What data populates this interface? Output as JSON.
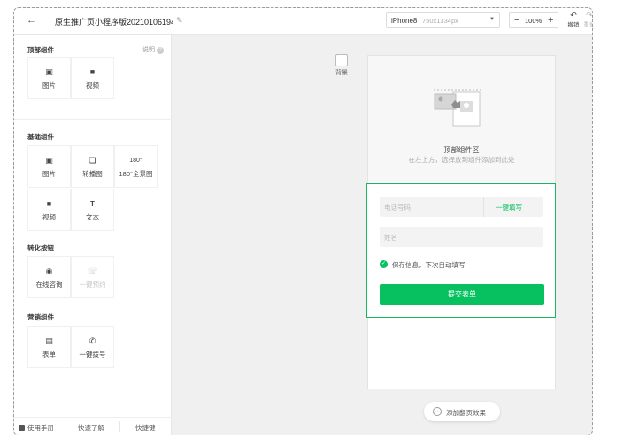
{
  "header": {
    "back_icon": "arrow-left-icon",
    "title": "原生推广页小程序版20210106194",
    "edit_icon": "pencil-icon",
    "device": {
      "name": "iPhone8",
      "resolution": "750x1334px"
    },
    "zoom": {
      "minus": "−",
      "value": "100%",
      "plus": "+"
    },
    "undo_label": "撤销",
    "redo_label": "重做"
  },
  "left_panel": {
    "help_label": "说明",
    "basic_title": "顶部组件",
    "basic_items": [
      {
        "label": "图片",
        "icon": "image-icon"
      },
      {
        "label": "视频",
        "icon": "video-icon"
      }
    ],
    "base_title": "基础组件",
    "base_items": [
      {
        "label": "图片",
        "icon": "image-icon"
      },
      {
        "label": "轮播图",
        "icon": "carousel-icon"
      },
      {
        "label": "180°全景图",
        "icon": "panorama-icon",
        "icon_text": "180°"
      },
      {
        "label": "视频",
        "icon": "video-icon"
      },
      {
        "label": "文本",
        "icon": "text-icon",
        "icon_text": "T"
      }
    ],
    "convert_title": "转化按钮",
    "convert_items": [
      {
        "label": "在线咨询",
        "icon": "chat-icon"
      },
      {
        "label": "一键预约",
        "icon": "phone-icon",
        "disabled": true
      }
    ],
    "marketing_title": "营销组件",
    "marketing_items": [
      {
        "label": "表单",
        "icon": "form-icon"
      },
      {
        "label": "一键拨号",
        "icon": "dial-icon"
      }
    ],
    "bottom_links": {
      "manual": "使用手册",
      "learn": "快速了解",
      "shortcut": "快捷键"
    }
  },
  "canvas": {
    "background_label": "背景",
    "drop_title": "顶部组件区",
    "drop_hint": "在左上方，选择放到组件添加到此处",
    "form": {
      "phone_placeholder": "电话号码",
      "autofill": "一键填写",
      "name_placeholder": "姓名",
      "save_info": "保存信息，下次自动填写",
      "submit": "提交表单"
    },
    "page_flip": "添加翻页效果"
  },
  "colors": {
    "accent": "#07c160",
    "selection_border": "#18b75f",
    "canvas_bg": "#f0f0f0"
  }
}
